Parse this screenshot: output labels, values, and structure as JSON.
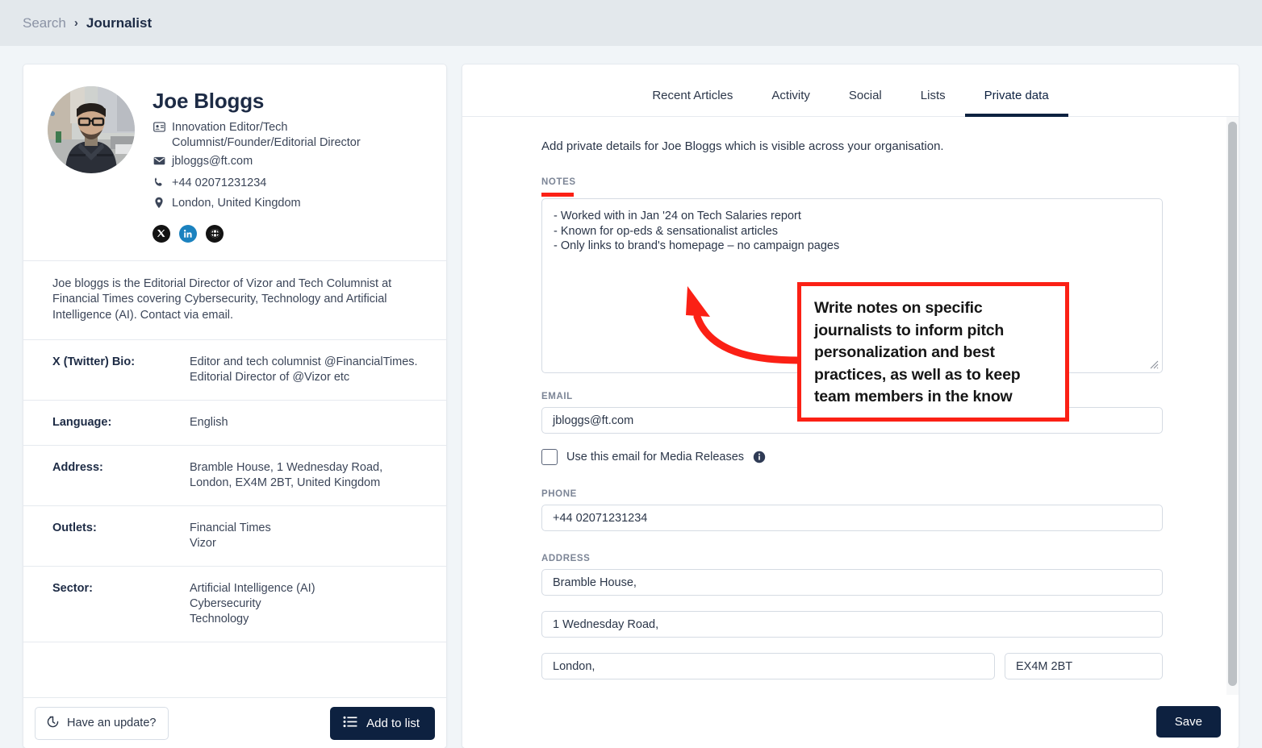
{
  "breadcrumb": {
    "parent": "Search",
    "separator": "›",
    "current": "Journalist"
  },
  "profile": {
    "name": "Joe Bloggs",
    "title": "Innovation Editor/Tech Columnist/Founder/Editorial Director",
    "email": "jbloggs@ft.com",
    "phone": "+44 02071231234",
    "location": "London, United Kingdom",
    "socials": [
      {
        "name": "x-twitter-icon",
        "label": "X"
      },
      {
        "name": "linkedin-icon",
        "label": "in"
      },
      {
        "name": "website-icon",
        "label": "globe"
      }
    ],
    "bio": "Joe bloggs is the Editorial Director of Vizor and Tech Columnist at Financial Times covering Cybersecurity, Technology and Artificial Intelligence (AI). Contact via email.",
    "details": [
      {
        "key": "X (Twitter) Bio:",
        "values": [
          "Editor and tech columnist @FinancialTimes.",
          "Editorial Director of @Vizor etc"
        ]
      },
      {
        "key": "Language:",
        "values": [
          "English"
        ]
      },
      {
        "key": "Address:",
        "values": [
          "Bramble House, 1 Wednesday Road,",
          "London, EX4M 2BT, United Kingdom"
        ]
      },
      {
        "key": "Outlets:",
        "values": [
          "Financial Times",
          "Vizor"
        ]
      },
      {
        "key": "Sector:",
        "values": [
          "Artificial Intelligence (AI)",
          "Cybersecurity",
          "Technology"
        ]
      }
    ],
    "footer": {
      "update_label": "Have an update?",
      "add_to_list_label": "Add to list"
    }
  },
  "tabs": [
    {
      "label": "Recent Articles",
      "active": false
    },
    {
      "label": "Activity",
      "active": false
    },
    {
      "label": "Social",
      "active": false
    },
    {
      "label": "Lists",
      "active": false
    },
    {
      "label": "Private data",
      "active": true
    }
  ],
  "private_data": {
    "intro": "Add private details for Joe Bloggs which is visible across your organisation.",
    "notes_label": "NOTES",
    "notes_value": "- Worked with in Jan '24 on Tech Salaries report\n- Known for op-eds & sensationalist articles\n- Only links to brand's homepage – no campaign pages",
    "email_label": "EMAIL",
    "email_value": "jbloggs@ft.com",
    "media_checkbox_label": "Use this email for Media Releases",
    "phone_label": "PHONE",
    "phone_value": "+44 02071231234",
    "address_label": "ADDRESS",
    "address_line1": "Bramble House,",
    "address_line2": "1 Wednesday Road,",
    "address_city": "London,",
    "address_postcode": "EX4M 2BT",
    "save_label": "Save"
  },
  "annotation": {
    "text": "Write notes on specific journalists to inform pitch personalization and best practices, as well as to keep team members in the know",
    "color": "#fb2015"
  },
  "colors": {
    "header_bg": "#e3e8ec",
    "page_bg": "#f1f5f8",
    "navy": "#0d2140",
    "accent_red": "#fb2015",
    "linkedin_blue": "#1b82bf"
  }
}
